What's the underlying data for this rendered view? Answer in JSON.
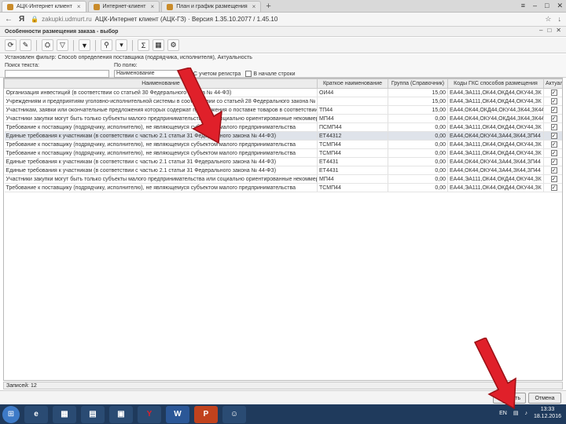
{
  "browser": {
    "tabs": [
      {
        "title": "АЦК-Интернет клиент",
        "active": true
      },
      {
        "title": "Интернет-клиент",
        "active": false
      },
      {
        "title": "План и график размещения",
        "active": false
      }
    ],
    "new_tab": "+",
    "address": {
      "domain": "zakupki.udmurt.ru",
      "title": "АЦК-Интернет клиент (АЦК-ГЗ) · Версия 1.35.10.2077 / 1.45.10"
    },
    "logo": "Я"
  },
  "app": {
    "window_title": "Особенности размещения заказа - выбор",
    "filter": {
      "set_filter": "Установлен фильтр: Способ определения поставщика (подрядчика, исполнителя), Актуальность",
      "search_label": "Поиск текста:",
      "field_label": "По полю:",
      "field_value": "Наименование",
      "check_case": "С учетом регистра",
      "check_whole": "В начале строки"
    },
    "columns": [
      "Наименование",
      "Краткое наименование",
      "Группа (Справочник)",
      "Коды ГКС способов размещения",
      "Актуальность"
    ],
    "rows": [
      {
        "name": "Организация инвестиций (в соответствии со статьей 30 Федерального закона № 44-ФЗ)",
        "short": "ОИ44",
        "group": "15,00",
        "codes": "ЕА44,ЭА111,ОК44,ОКД44,ОКУ44,ЗК",
        "active": "✓"
      },
      {
        "name": "Учреждениям и предприятиям уголовно-исполнительной системы в соответствии со статьей 28 Федерального закона № 44-ФЗ",
        "short": "",
        "group": "15,00",
        "codes": "ЕА44,ЭА111,ОК44,ОКД44,ОКУ44,ЗК",
        "active": "✓"
      },
      {
        "name": "Участникам, заявки или окончательные предложения которых содержат предложения о поставке товаров в соответствии с приказом",
        "short": "ТП44",
        "group": "15,00",
        "codes": "ЕА44,ОК44,ОКД44,ОКУ44,ЗК44,ЗК44",
        "active": "✓"
      },
      {
        "name": "Участники закупки могут быть только субъекты малого предпринимательства или социально ориентированные некоммерческие организации",
        "short": "МП44",
        "group": "0,00",
        "codes": "ЕА44,ОК44,ОКУ44,ОКД44,ЗК44,ЗК44",
        "active": "✓"
      },
      {
        "name": "Требование к поставщику (подрядчику, исполнителю), не являющемуся субъектом малого предпринимательства",
        "short": "ПСМП44",
        "group": "0,00",
        "codes": "ЕА44,ЭА111,ОК44,ОКД44,ОКУ44,ЗК",
        "active": "✓"
      },
      {
        "name": "Единые требования к участникам (в соответствии с частью 2.1 статьи 31 Федерального закона № 44-ФЗ)",
        "short": "ЕТ44312",
        "group": "0,00",
        "codes": "ЕА44,ОК44,ОКУ44,ЗА44,ЗК44,ЗП44",
        "active": "✓"
      },
      {
        "name": "Требование к поставщику (подрядчику, исполнителю), не являющемуся субъектом малого предпринимательства",
        "short": "ТСМП44",
        "group": "0,00",
        "codes": "ЕА44,ЭА111,ОК44,ОКД44,ОКУ44,ЗК",
        "active": "✓"
      },
      {
        "name": "Требование к поставщику (подрядчику, исполнителю), не являющемуся субъектом малого предпринимательства",
        "short": "ТСМП44",
        "group": "0,00",
        "codes": "ЕА44,ЭА111,ОК44,ОКД44,ОКУ44,ЗК",
        "active": "✓"
      },
      {
        "name": "Единые требования к участникам (в соответствии с частью 2.1 статьи 31 Федерального закона № 44-ФЗ)",
        "short": "ЕТ4431",
        "group": "0,00",
        "codes": "ЕА44,ОК44,ОКУ44,ЗА44,ЗК44,ЗП44",
        "active": "✓"
      },
      {
        "name": "Единые требования к участникам (в соответствии с частью 2.1 статьи 31 Федерального закона № 44-ФЗ)",
        "short": "ЕТ4431",
        "group": "0,00",
        "codes": "ЕА44,ОК44,ОКУ44,ЗА44,ЗК44,ЗП44",
        "active": "✓"
      },
      {
        "name": "Участники закупки могут быть только субъекты малого предпринимательства или социально ориентированные некоммерческие организации",
        "short": "МП44",
        "group": "0,00",
        "codes": "ЕА44,ЭА111,ОК44,ОКД44,ОКУ44,ЗК",
        "active": "✓"
      },
      {
        "name": "Требование к поставщику (подрядчику, исполнителю), не являющемуся субъектом малого предпринимательства",
        "short": "ТСМП44",
        "group": "0,00",
        "codes": "ЕА44,ЭА111,ОК44,ОКД44,ОКУ44,ЗК",
        "active": "✓"
      }
    ],
    "records": "Записей: 12",
    "buttons": {
      "choose": "Выбрать",
      "cancel": "Отмена"
    }
  },
  "taskbar": {
    "apps": [
      "e",
      "▦",
      "▤",
      "▣",
      "Y",
      "W",
      "P",
      "☺"
    ],
    "lang": "EN",
    "time": "13:33",
    "date": "18.12.2016"
  },
  "colors": {
    "arrow": "#e0202a",
    "taskbar": "#1f3a5c"
  }
}
